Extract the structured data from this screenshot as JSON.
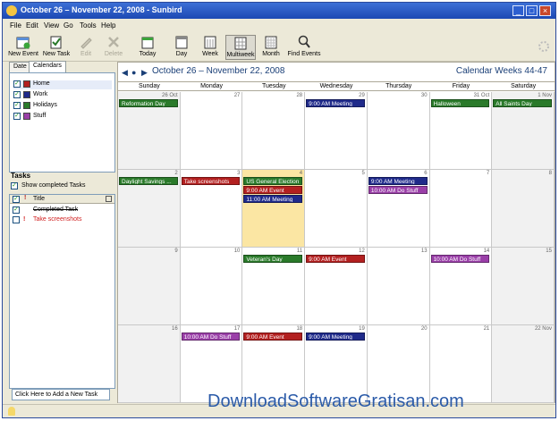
{
  "window": {
    "title": "October 26 – November 22, 2008 - Sunbird"
  },
  "menu": [
    "File",
    "Edit",
    "View",
    "Go",
    "Tools",
    "Help"
  ],
  "toolbar": {
    "new_event": "New Event",
    "new_task": "New Task",
    "edit": "Edit",
    "delete": "Delete",
    "today": "Today",
    "day": "Day",
    "week": "Week",
    "multiweek": "Multiweek",
    "month": "Month",
    "find_events": "Find Events"
  },
  "left": {
    "tabs": [
      "Date",
      "Calendars"
    ],
    "calendars": [
      {
        "name": "Home",
        "color": "#b32020"
      },
      {
        "name": "Work",
        "color": "#1f2a8a"
      },
      {
        "name": "Holidays",
        "color": "#2a7a2a"
      },
      {
        "name": "Stuff",
        "color": "#9a3fa8"
      }
    ],
    "tasks_title": "Tasks",
    "show_completed": "Show completed Tasks",
    "task_header_title": "Title",
    "tasks": [
      {
        "title": "Completed Task",
        "done": true
      },
      {
        "title": "Take screenshots",
        "done": false
      }
    ],
    "add_task_placeholder": "Click Here to Add a New Task"
  },
  "main": {
    "range": "October 26 – November 22, 2008",
    "weeks": "Calendar Weeks 44-47",
    "days": [
      "Sunday",
      "Monday",
      "Tuesday",
      "Wednesday",
      "Thursday",
      "Friday",
      "Saturday"
    ],
    "week_rows": [
      [
        "26 Oct",
        "27",
        "28",
        "29",
        "30",
        "31 Oct",
        "1 Nov"
      ],
      [
        "2",
        "3",
        "4",
        "5",
        "6",
        "7",
        "8"
      ],
      [
        "9",
        "10",
        "11",
        "12",
        "13",
        "14",
        "15"
      ],
      [
        "16",
        "17",
        "18",
        "19",
        "20",
        "21",
        "22 Nov"
      ]
    ],
    "events": [
      {
        "row": 0,
        "col": 0,
        "slot": 0,
        "label": "Reformation Day",
        "color": "#2a7a2a"
      },
      {
        "row": 0,
        "col": 3,
        "slot": 0,
        "label": "9:00 AM Meeting",
        "color": "#1f2a8a"
      },
      {
        "row": 0,
        "col": 5,
        "slot": 0,
        "label": "Halloween",
        "color": "#2a7a2a"
      },
      {
        "row": 0,
        "col": 6,
        "slot": 0,
        "label": "All Saints Day",
        "color": "#2a7a2a"
      },
      {
        "row": 1,
        "col": 0,
        "slot": 0,
        "label": "Daylight Savings ...",
        "color": "#2a7a2a"
      },
      {
        "row": 1,
        "col": 1,
        "slot": 0,
        "label": "Take screenshots",
        "color": "#b32020"
      },
      {
        "row": 1,
        "col": 2,
        "slot": 0,
        "label": "US General Election",
        "color": "#2a7a2a"
      },
      {
        "row": 1,
        "col": 2,
        "slot": 1,
        "label": "9:00 AM Event",
        "color": "#b32020"
      },
      {
        "row": 1,
        "col": 2,
        "slot": 2,
        "label": "11:00 AM Meeting",
        "color": "#1f2a8a"
      },
      {
        "row": 1,
        "col": 4,
        "slot": 0,
        "label": "9:00 AM Meeting",
        "color": "#1f2a8a"
      },
      {
        "row": 1,
        "col": 4,
        "slot": 1,
        "label": "10:00 AM Do Stuff",
        "color": "#9a3fa8"
      },
      {
        "row": 2,
        "col": 2,
        "slot": 0,
        "label": "Veteran's Day",
        "color": "#2a7a2a"
      },
      {
        "row": 2,
        "col": 3,
        "slot": 0,
        "label": "9:00 AM Event",
        "color": "#b32020"
      },
      {
        "row": 2,
        "col": 5,
        "slot": 0,
        "label": "10:00 AM Do Stuff",
        "color": "#9a3fa8"
      },
      {
        "row": 3,
        "col": 1,
        "slot": 0,
        "label": "10:00 AM Do Stuff",
        "color": "#9a3fa8"
      },
      {
        "row": 3,
        "col": 2,
        "slot": 0,
        "label": "9:00 AM Event",
        "color": "#b32020"
      },
      {
        "row": 3,
        "col": 3,
        "slot": 0,
        "label": "9:00 AM Meeting",
        "color": "#1f2a8a"
      }
    ],
    "today": {
      "row": 1,
      "col": 2
    }
  },
  "watermark": "DownloadSoftwareGratisan.com"
}
